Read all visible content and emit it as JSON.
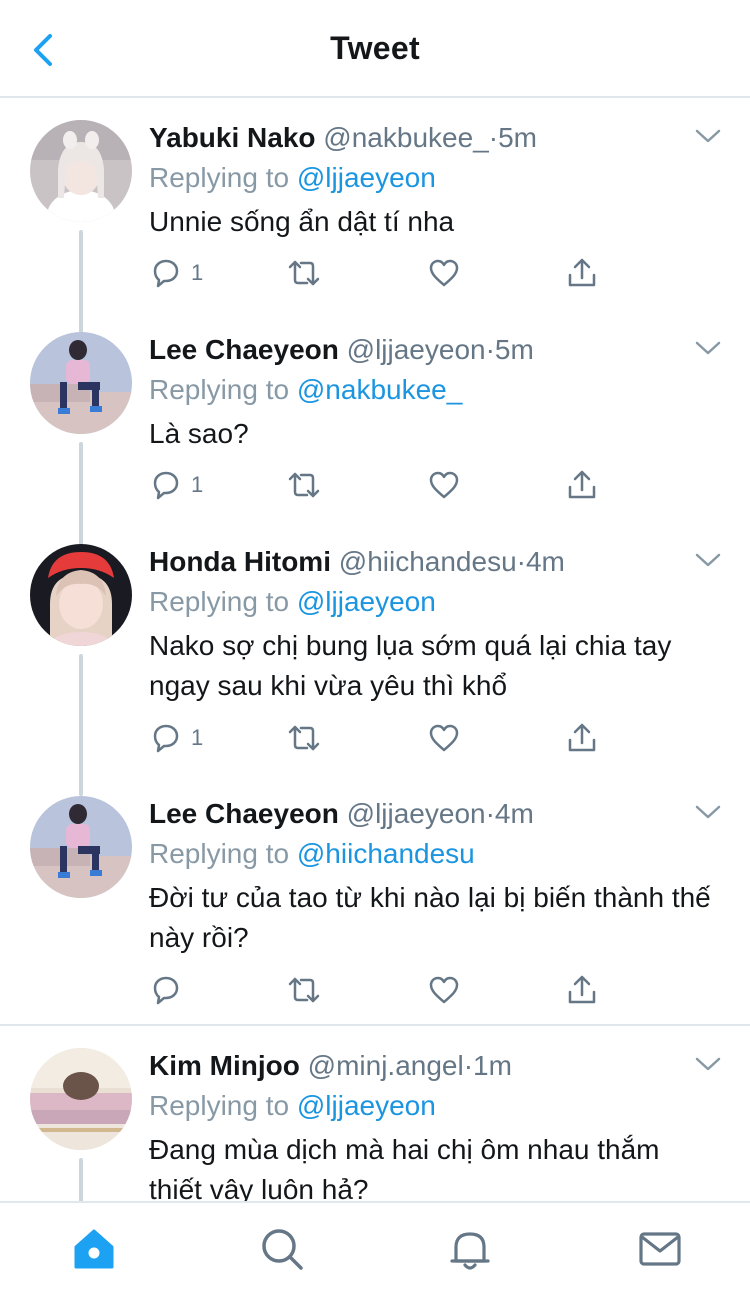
{
  "header": {
    "title": "Tweet",
    "back_icon": "chevron-left-icon"
  },
  "colors": {
    "accent": "#1da1f2",
    "link": "#1b95e0",
    "muted": "#657786",
    "border": "#e1e8ed"
  },
  "tweets": [
    {
      "name": "Yabuki Nako",
      "handle": "@nakbukee_",
      "dot": "·",
      "time": "5m",
      "replying_label": "Replying to",
      "replying_to": "@ljjaeyeon",
      "text": "Unnie sống ẩn dật tí nha",
      "reply_count": "1"
    },
    {
      "name": "Lee Chaeyeon",
      "handle": "@ljjaeyeon",
      "dot": "·",
      "time": "5m",
      "replying_label": "Replying to",
      "replying_to": "@nakbukee_",
      "text": "Là sao?",
      "reply_count": "1"
    },
    {
      "name": "Honda Hitomi",
      "handle": "@hiichandesu",
      "dot": "·",
      "time": "4m",
      "replying_label": "Replying to",
      "replying_to": "@ljjaeyeon",
      "text": "Nako sợ chị bung lụa sớm quá lại chia tay ngay sau khi vừa yêu thì khổ",
      "reply_count": "1"
    },
    {
      "name": "Lee Chaeyeon",
      "handle": "@ljjaeyeon",
      "dot": "·",
      "time": "4m",
      "replying_label": "Replying to",
      "replying_to": "@hiichandesu",
      "text": "Đời tư của tao từ khi nào lại bị biến thành thế này rồi?",
      "reply_count": ""
    },
    {
      "name": "Kim Minjoo",
      "handle": "@minj.angel",
      "dot": "·",
      "time": "1m",
      "replying_label": "Replying to",
      "replying_to": "@ljjaeyeon",
      "text": "Đang mùa dịch mà hai chị ôm nhau thắm thiết vậy luôn hả?",
      "reply_count": ""
    }
  ],
  "tabbar": {
    "items": [
      "home-icon",
      "search-icon",
      "notifications-icon",
      "messages-icon"
    ]
  }
}
